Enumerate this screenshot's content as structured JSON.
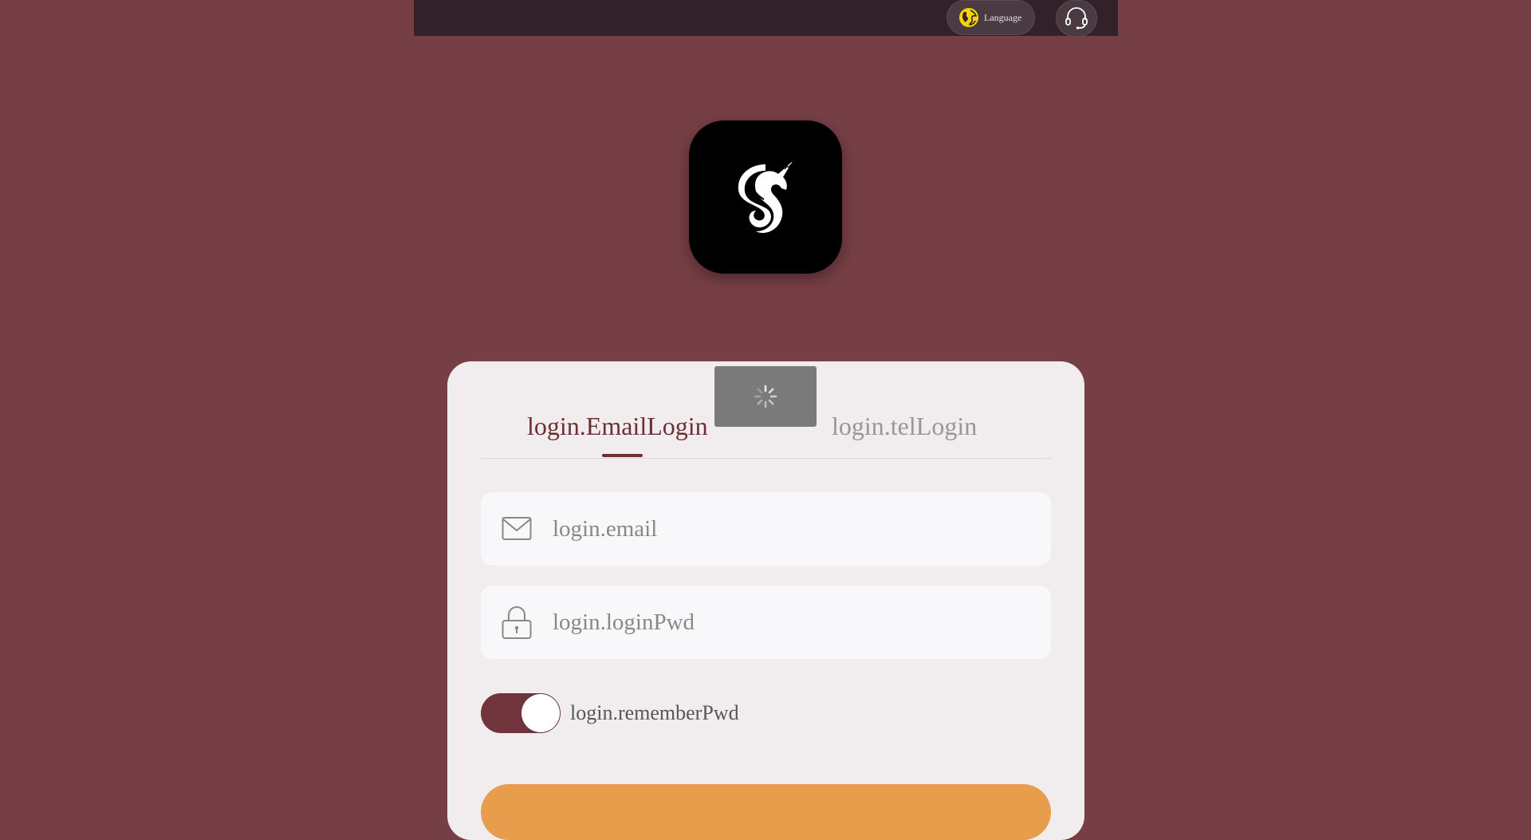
{
  "header": {
    "language_label": "Language",
    "language_icon": "globe-icon",
    "support_icon": "headset-icon"
  },
  "logo": {
    "icon": "unicorn-s-logo"
  },
  "tabs": {
    "email_login": "login.EmailLogin",
    "tel_login": "login.telLogin"
  },
  "form": {
    "email_placeholder": "login.email",
    "password_placeholder": "login.loginPwd",
    "remember_label": "login.rememberPwd",
    "remember_on": true
  },
  "colors": {
    "background": "#763f45",
    "topbar": "#33212a",
    "accent": "#6b2f37",
    "login_button": "#e89d4c"
  }
}
